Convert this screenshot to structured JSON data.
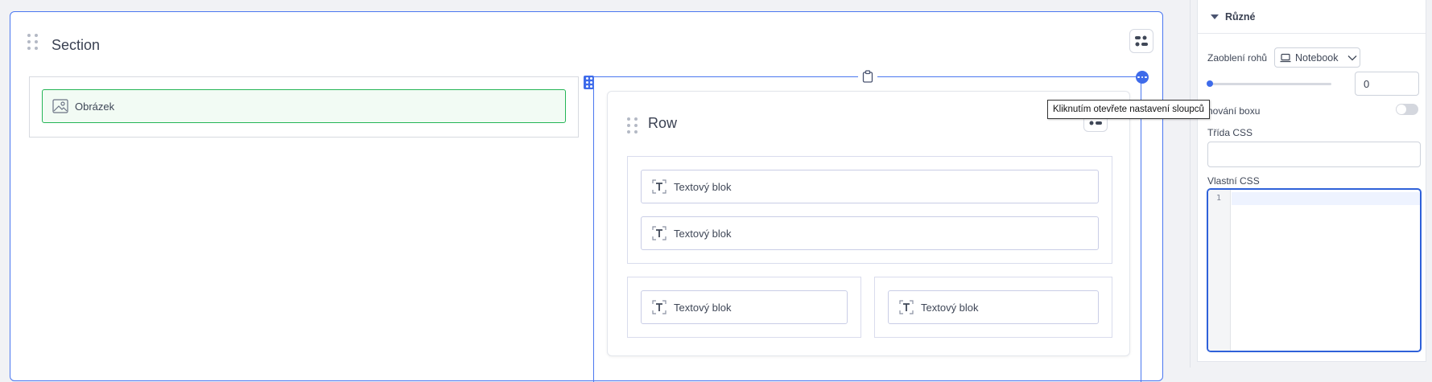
{
  "canvas": {
    "section": {
      "title": "Section"
    },
    "left_column": {
      "image_block": {
        "label": "Obrázek",
        "icon": "image-icon"
      }
    },
    "right_column": {
      "row": {
        "title": "Row"
      },
      "text_blocks": [
        {
          "label": "Textový blok"
        },
        {
          "label": "Textový blok"
        },
        {
          "label": "Textový blok"
        },
        {
          "label": "Textový blok"
        }
      ]
    },
    "tooltip": "Kliknutím otevřete nastavení sloupců"
  },
  "panel": {
    "header": {
      "title": "Různé"
    },
    "border_radius": {
      "label": "Zaoblení rohů",
      "device": "Notebook",
      "value": "0",
      "slider_fraction": 0
    },
    "box_shadow": {
      "label_visible": "nování boxu",
      "enabled": false
    },
    "css_class": {
      "label": "Třída CSS",
      "value": ""
    },
    "custom_css": {
      "label": "Vlastní CSS",
      "line_number": "1"
    }
  },
  "colors": {
    "accent": "#3e6bea",
    "selected_green": "#24b556",
    "section_border": "#4a77f0"
  }
}
